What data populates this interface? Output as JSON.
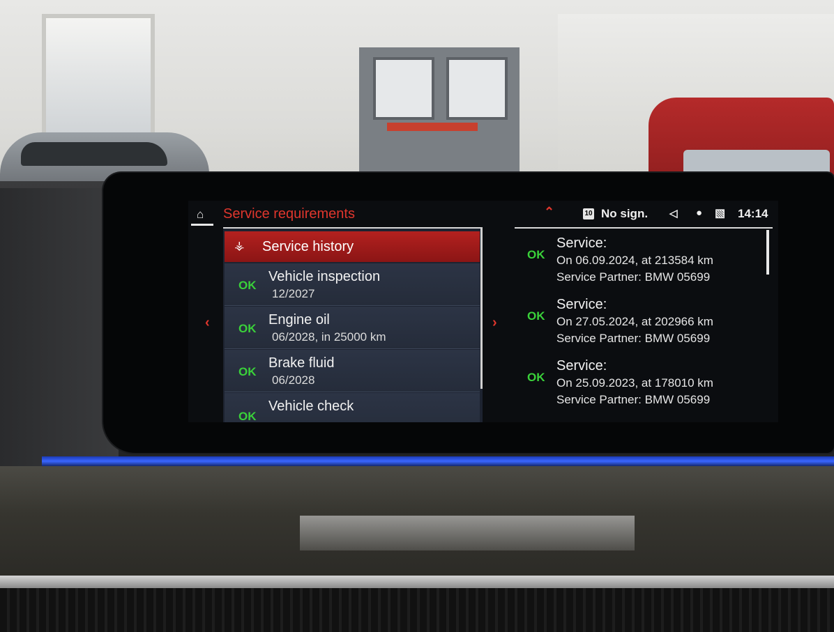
{
  "header": {
    "title": "Service requirements",
    "home_icon": "home-icon"
  },
  "status_bar": {
    "sim_badge": "10",
    "signal": "No sign.",
    "time": "14:14",
    "icons": [
      "chevron-up-icon",
      "sim-icon",
      "speaker-icon",
      "microphone-icon",
      "profile-icon"
    ]
  },
  "service_history_button": {
    "label": "Service history",
    "icon": "car-service-icon"
  },
  "requirements": [
    {
      "status": "OK",
      "name": "Vehicle inspection",
      "detail": "12/2027"
    },
    {
      "status": "OK",
      "name": "Engine oil",
      "detail": "06/2028, in 25000 km"
    },
    {
      "status": "OK",
      "name": "Brake fluid",
      "detail": "06/2028"
    },
    {
      "status": "OK",
      "name": "Vehicle check",
      "detail": ""
    }
  ],
  "history": [
    {
      "status": "OK",
      "title": "Service:",
      "line1": "On 06.09.2024, at 213584 km",
      "line2": "Service Partner: BMW 05699"
    },
    {
      "status": "OK",
      "title": "Service:",
      "line1": "On 27.05.2024, at 202966 km",
      "line2": "Service Partner: BMW 05699"
    },
    {
      "status": "OK",
      "title": "Service:",
      "line1": "On 25.09.2023, at 178010 km",
      "line2": "Service Partner: BMW 05699"
    }
  ],
  "colors": {
    "accent_red": "#e0362d",
    "ok_green": "#3ad13a",
    "ambient_blue": "#3a66ff"
  }
}
